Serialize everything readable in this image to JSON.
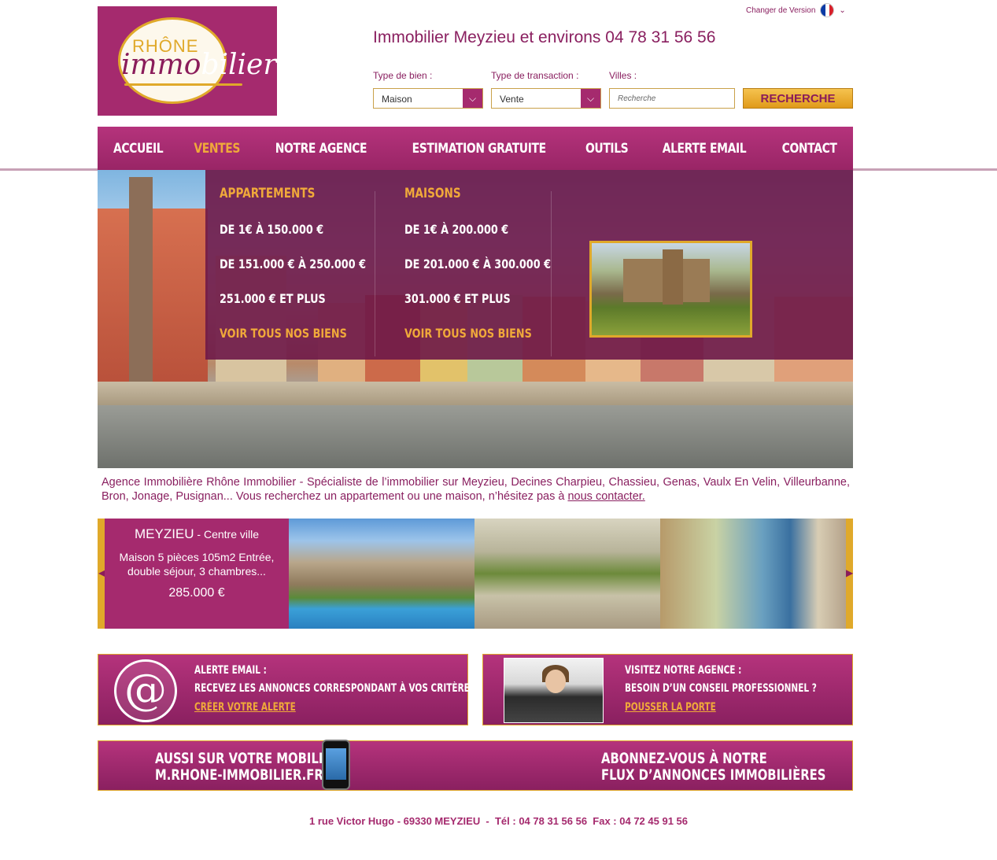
{
  "version": {
    "label": "Changer de Version",
    "flag_icon": "france-flag-icon"
  },
  "logo": {
    "line1": "RHÔNE",
    "line2_a": "immo",
    "line2_b": "bilier"
  },
  "header": {
    "title": "Immobilier Meyzieu et environs 04 78 31 56 56"
  },
  "search": {
    "type_label": "Type de bien :",
    "type_value": "Maison",
    "transaction_label": "Type de transaction :",
    "transaction_value": "Vente",
    "city_label": "Villes :",
    "city_placeholder": "Recherche",
    "button": "RECHERCHE"
  },
  "nav": {
    "items": [
      "ACCUEIL",
      "VENTES",
      "NOTRE AGENCE",
      "ESTIMATION GRATUITE",
      "OUTILS",
      "ALERTE EMAIL",
      "CONTACT"
    ],
    "active": "VENTES"
  },
  "dropdown": {
    "apartments": {
      "title": "APPARTEMENTS",
      "items": [
        "DE 1€ À 150.000 €",
        "DE 151.000 € À 250.000 €",
        "251.000 € ET PLUS"
      ],
      "all": "VOIR TOUS NOS BIENS"
    },
    "houses": {
      "title": "MAISONS",
      "items": [
        "DE 1€ À 200.000 €",
        "DE 201.000 € À 300.000 €",
        "301.000 € ET PLUS"
      ],
      "all": "VOIR TOUS NOS BIENS"
    }
  },
  "intro": {
    "text": "Agence Immobilière Rhône Immobilier - Spécialiste de l’immobilier sur Meyzieu, Decines Charpieu, Chassieu, Genas, Vaulx En Velin, Villeurbanne, Bron, Jonage, Pusignan... Vous recherchez un appartement ou une maison, n’hésitez pas à ",
    "link": "nous contacter."
  },
  "listing": {
    "city": "MEYZIEU",
    "area": " - Centre ville",
    "desc": "Maison 5 pièces 105m2 Entrée, double séjour, 3 chambres...",
    "price": "285.000 €"
  },
  "promo_alert": {
    "title": "ALERTE EMAIL :",
    "text": "RECEVEZ LES ANNONCES CORRESPONDANT À VOS CRITÈRES",
    "link": "CRÉER VOTRE ALERTE"
  },
  "promo_agency": {
    "title": "VISITEZ NOTRE AGENCE :",
    "text": "BESOIN D’UN CONSEIL PROFESSIONNEL ?",
    "link": "POUSSER LA PORTE"
  },
  "banner": {
    "mobile_1": "AUSSI SUR VOTRE MOBILE",
    "mobile_2": "M.RHONE-IMMOBILIER.FR",
    "feed_1": "ABONNEZ-VOUS À NOTRE",
    "feed_2": "FLUX D’ANNONCES IMMOBILIÈRES"
  },
  "footer": {
    "text": "1 rue Victor Hugo - 69330 MEYZIEU  -  Tél : 04 78 31 56 56  Fax : 04 72 45 91 56"
  },
  "colors": {
    "brand": "#a52a6e",
    "gold": "#e0a92a",
    "orange": "#f0a93a"
  }
}
